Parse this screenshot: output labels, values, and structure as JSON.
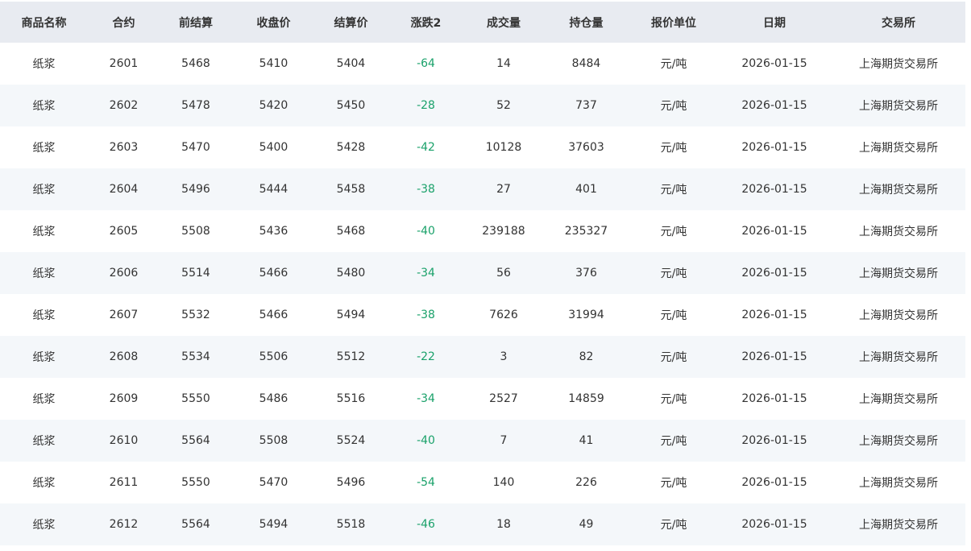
{
  "table": {
    "columns": [
      "商品名称",
      "合约",
      "前结算",
      "收盘价",
      "结算价",
      "涨跌2",
      "成交量",
      "持仓量",
      "报价单位",
      "日期",
      "交易所"
    ],
    "rows": [
      [
        "纸浆",
        "2601",
        "5468",
        "5410",
        "5404",
        "-64",
        "14",
        "8484",
        "元/吨",
        "2026-01-15",
        "上海期货交易所"
      ],
      [
        "纸浆",
        "2602",
        "5478",
        "5420",
        "5450",
        "-28",
        "52",
        "737",
        "元/吨",
        "2026-01-15",
        "上海期货交易所"
      ],
      [
        "纸浆",
        "2603",
        "5470",
        "5400",
        "5428",
        "-42",
        "10128",
        "37603",
        "元/吨",
        "2026-01-15",
        "上海期货交易所"
      ],
      [
        "纸浆",
        "2604",
        "5496",
        "5444",
        "5458",
        "-38",
        "27",
        "401",
        "元/吨",
        "2026-01-15",
        "上海期货交易所"
      ],
      [
        "纸浆",
        "2605",
        "5508",
        "5436",
        "5468",
        "-40",
        "239188",
        "235327",
        "元/吨",
        "2026-01-15",
        "上海期货交易所"
      ],
      [
        "纸浆",
        "2606",
        "5514",
        "5466",
        "5480",
        "-34",
        "56",
        "376",
        "元/吨",
        "2026-01-15",
        "上海期货交易所"
      ],
      [
        "纸浆",
        "2607",
        "5532",
        "5466",
        "5494",
        "-38",
        "7626",
        "31994",
        "元/吨",
        "2026-01-15",
        "上海期货交易所"
      ],
      [
        "纸浆",
        "2608",
        "5534",
        "5506",
        "5512",
        "-22",
        "3",
        "82",
        "元/吨",
        "2026-01-15",
        "上海期货交易所"
      ],
      [
        "纸浆",
        "2609",
        "5550",
        "5486",
        "5516",
        "-34",
        "2527",
        "14859",
        "元/吨",
        "2026-01-15",
        "上海期货交易所"
      ],
      [
        "纸浆",
        "2610",
        "5564",
        "5508",
        "5524",
        "-40",
        "7",
        "41",
        "元/吨",
        "2026-01-15",
        "上海期货交易所"
      ],
      [
        "纸浆",
        "2611",
        "5550",
        "5470",
        "5496",
        "-54",
        "140",
        "226",
        "元/吨",
        "2026-01-15",
        "上海期货交易所"
      ],
      [
        "纸浆",
        "2612",
        "5564",
        "5494",
        "5518",
        "-46",
        "18",
        "49",
        "元/吨",
        "2026-01-15",
        "上海期货交易所"
      ]
    ]
  },
  "colors": {
    "header_bg": "#e8ebf1",
    "stripe_bg": "#f4f7fa",
    "text": "#333333",
    "down": "#1aa16a"
  }
}
